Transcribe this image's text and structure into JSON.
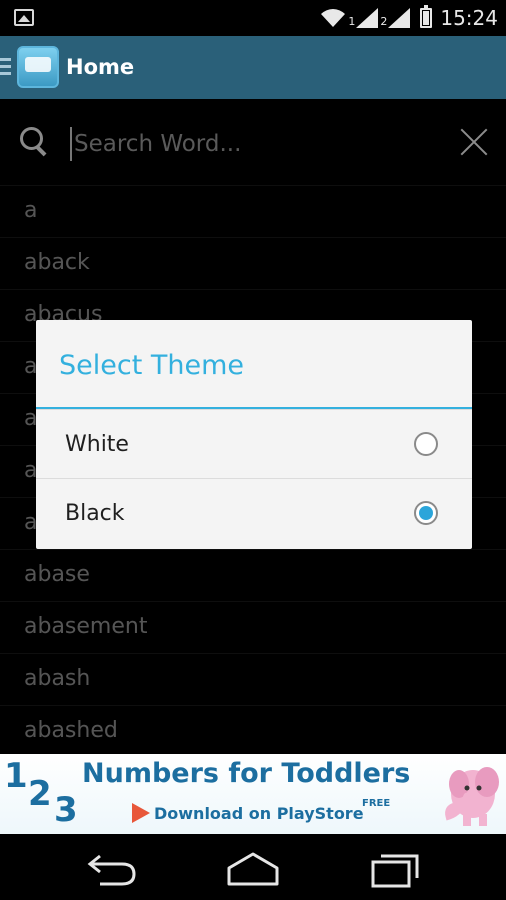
{
  "status_bar": {
    "time": "15:24",
    "sim1": "1",
    "sim2": "2",
    "icons": [
      "image-icon",
      "wifi-icon",
      "signal-icon",
      "signal-icon",
      "battery-icon"
    ]
  },
  "action_bar": {
    "title": "Home",
    "logo_icon": "app-logo-icon",
    "menu_icon": "hamburger-icon",
    "color": "#2a6079"
  },
  "search": {
    "placeholder": "Search Word...",
    "value": ""
  },
  "word_list": [
    "a",
    "aback",
    "abacus",
    "a",
    "a",
    "a",
    "a",
    "abase",
    "abasement",
    "abash",
    "abashed"
  ],
  "dialog": {
    "title": "Select Theme",
    "accent": "#33b0de",
    "options": [
      {
        "label": "White",
        "selected": false
      },
      {
        "label": "Black",
        "selected": true
      }
    ]
  },
  "ad_banner": {
    "digits": [
      "1",
      "2",
      "3"
    ],
    "title": "Numbers for Toddlers",
    "subtitle": "Download on PlayStore",
    "badge": "FREE"
  },
  "nav_bar": {
    "buttons": [
      "back-icon",
      "home-icon",
      "recent-apps-icon"
    ]
  }
}
